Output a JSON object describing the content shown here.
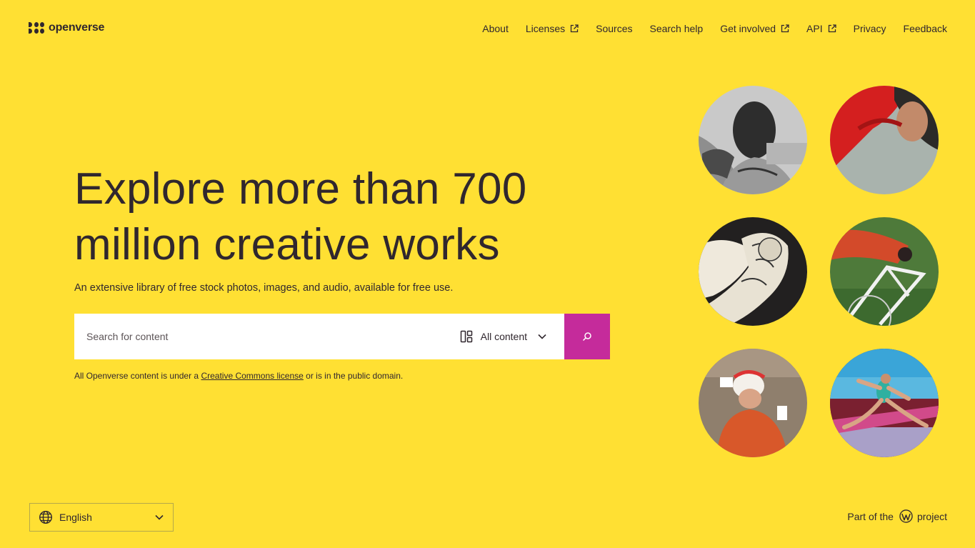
{
  "header": {
    "logo_text": "openverse",
    "nav": [
      {
        "label": "About",
        "external": false
      },
      {
        "label": "Licenses",
        "external": true
      },
      {
        "label": "Sources",
        "external": false
      },
      {
        "label": "Search help",
        "external": false
      },
      {
        "label": "Get involved",
        "external": true
      },
      {
        "label": "API",
        "external": true
      },
      {
        "label": "Privacy",
        "external": false
      },
      {
        "label": "Feedback",
        "external": false
      }
    ]
  },
  "hero": {
    "headline_line1": "Explore more than 700",
    "headline_line2": "million creative works",
    "subline": "An extensive library of free stock photos, images, and audio, available for free use."
  },
  "search": {
    "placeholder": "Search for content",
    "content_type_label": "All content",
    "button_icon": "search-icon"
  },
  "license_note": {
    "before": "All Openverse content is under a ",
    "link": "Creative Commons license",
    "after": " or is in the public domain."
  },
  "gallery": [
    {
      "name": "athlete-portrait-bw"
    },
    {
      "name": "athlete-red-shirt"
    },
    {
      "name": "wrestlers-illustration"
    },
    {
      "name": "track-cyclist"
    },
    {
      "name": "cyclist-helmet"
    },
    {
      "name": "sprinter-running"
    }
  ],
  "footer": {
    "language": "English",
    "wp_before": "Part of the",
    "wp_after": "project"
  },
  "colors": {
    "background": "#ffe033",
    "text": "#30272e",
    "accent": "#c52b9b"
  }
}
